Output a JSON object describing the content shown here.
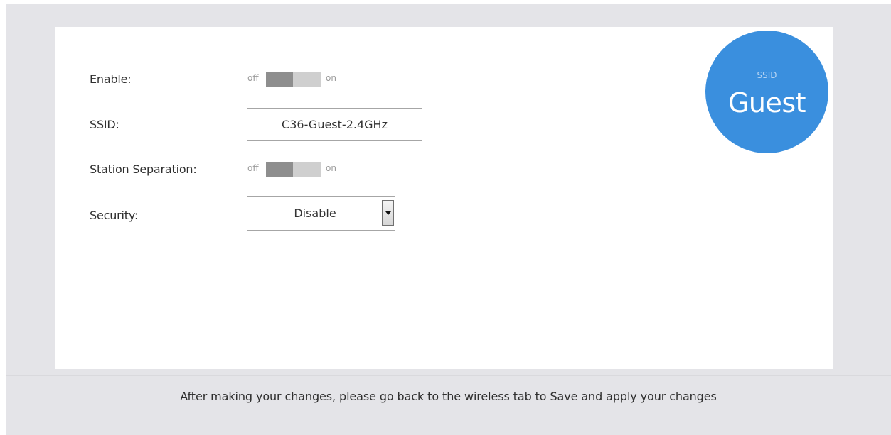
{
  "form": {
    "enable": {
      "label": "Enable:",
      "off_text": "off",
      "on_text": "on",
      "state": "off"
    },
    "ssid": {
      "label": "SSID:",
      "value": "C36-Guest-2.4GHz"
    },
    "station_separation": {
      "label": "Station Separation:",
      "off_text": "off",
      "on_text": "on",
      "state": "off"
    },
    "security": {
      "label": "Security:",
      "selected": "Disable"
    }
  },
  "badge": {
    "caption": "SSID",
    "name": "Guest",
    "color": "#3a8fde"
  },
  "footer": {
    "note": "After making your changes, please go back to the wireless tab to Save and apply your changes"
  },
  "colors": {
    "background": "#e4e4e8",
    "panel": "#ffffff",
    "toggle_track": "#cfcfcf",
    "toggle_knob": "#8e8e8e"
  }
}
